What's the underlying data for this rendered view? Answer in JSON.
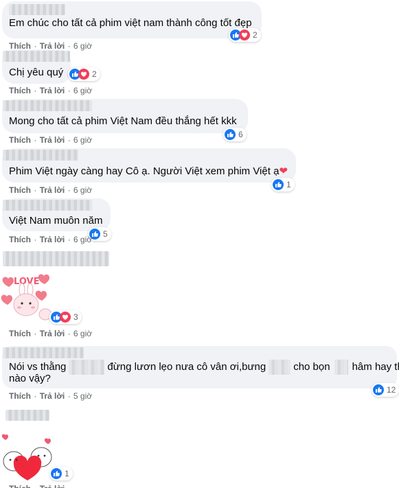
{
  "actions": {
    "like": "Thích",
    "reply": "Trả lời",
    "dot": "·"
  },
  "comments": [
    {
      "text": "Em chúc cho tất cả phim việt nam thành công tốt đẹp",
      "time": "6 giờ",
      "count": "2"
    },
    {
      "text": "Chị yêu quý",
      "time": "6 giờ",
      "count": "2"
    },
    {
      "text": "Mong cho tất cả phim Việt Nam đều thắng hết kkk",
      "time": "6 giờ",
      "count": "6"
    },
    {
      "text": "Phim Việt ngày càng hay Cô ạ. Người Việt xem phim Việt ạ",
      "time": "6 giờ",
      "count": "1"
    },
    {
      "text": "Việt Nam muôn năm",
      "time": "6 giờ",
      "count": "5"
    },
    {
      "text": "",
      "time": "6 giờ",
      "count": "3"
    },
    {
      "text_parts": [
        "Nói vs thằng",
        "đừng lươn lẹo nưa cô vân ơi,bưng",
        "cho bọn",
        "hâm hay thế"
      ],
      "text_line2": "nào vậy?",
      "time": "5 giờ",
      "count": "12"
    },
    {
      "text": "",
      "time": "",
      "count": "1"
    }
  ],
  "sticker_text": "LOVE",
  "colors": {
    "like": "#1877f2",
    "love": "#f33e58",
    "bubble": "#f0f2f5",
    "meta": "#65676b"
  }
}
